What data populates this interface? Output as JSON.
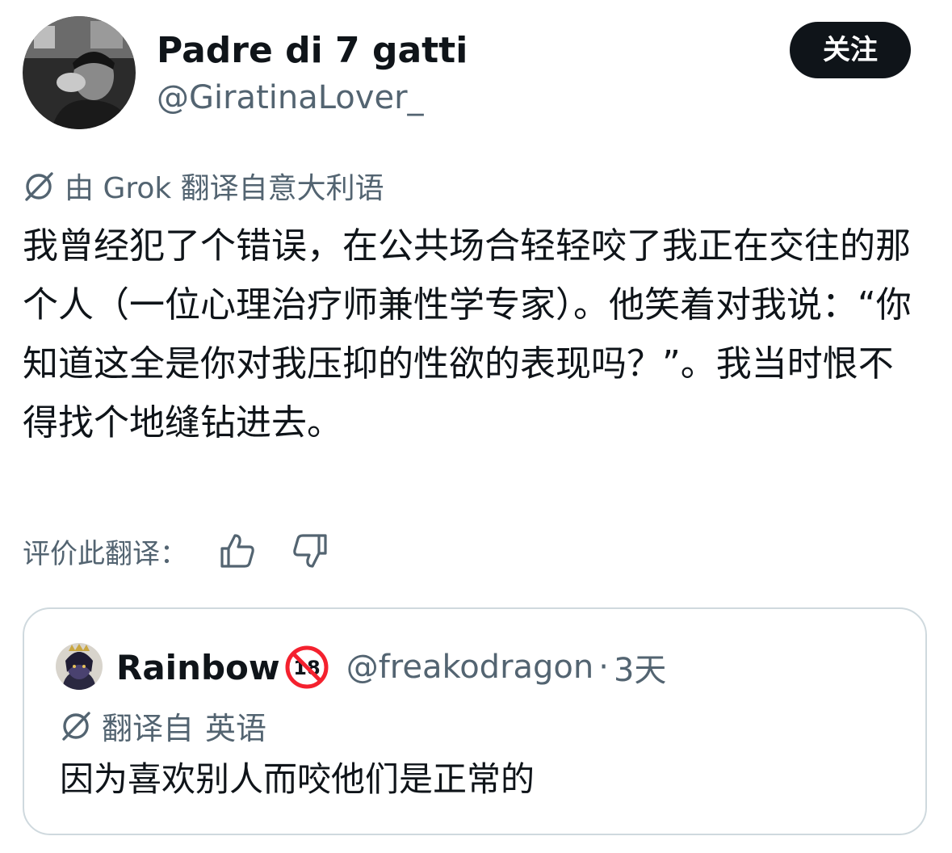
{
  "author": {
    "display_name": "Padre di 7 gatti",
    "handle": "@GiratinaLover_",
    "avatar_icon": "user-avatar-photo"
  },
  "follow_button": {
    "label": "关注"
  },
  "translation_notice": {
    "text": "由 Grok 翻译自意大利语",
    "icon": "no-translate-icon"
  },
  "tweet": {
    "text": "我曾经犯了个错误，在公共场合轻轻咬了我正在交往的那个人（一位心理治疗师兼性学专家）。他笑着对我说：“你知道这全是你对我压抑的性欲的表现吗？”。我当时恨不得找个地缝钻进去。"
  },
  "rate_translation": {
    "label": "评价此翻译：",
    "thumbs_up_icon": "thumbs-up-icon",
    "thumbs_down_icon": "thumbs-down-icon"
  },
  "quoted_tweet": {
    "display_name": "Rainbow",
    "badge_icon": "no-under-18-icon",
    "handle": "@freakodragon",
    "separator": "·",
    "time": "3天",
    "translated_label": "翻译自",
    "translated_lang": "英语",
    "text": "因为喜欢别人而咬他们是正常的"
  },
  "colors": {
    "text_primary": "#0f1419",
    "text_secondary": "#536471",
    "border": "#cfd9de",
    "button_bg": "#0f1419",
    "button_text": "#ffffff"
  }
}
